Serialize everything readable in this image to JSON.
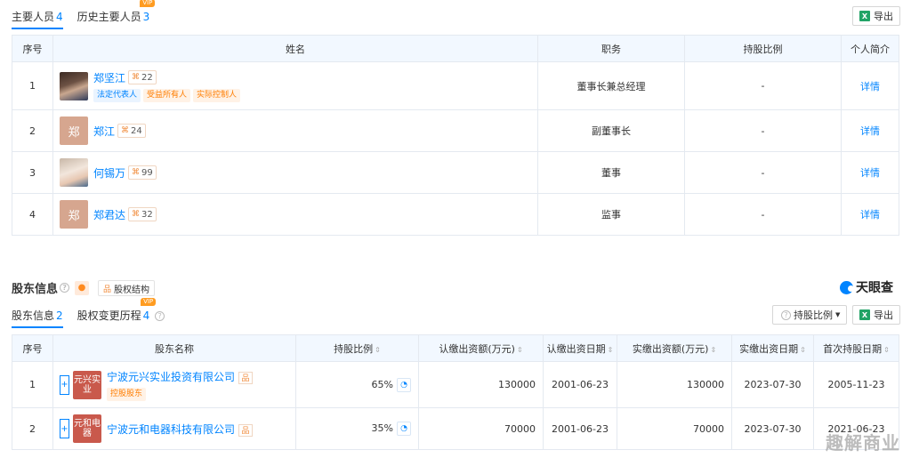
{
  "personnel": {
    "tabs": [
      {
        "label": "主要人员",
        "count": "4"
      },
      {
        "label": "历史主要人员",
        "count": "3",
        "badge": "VIP"
      }
    ],
    "export_label": "导出",
    "columns": [
      "序号",
      "姓名",
      "职务",
      "持股比例",
      "个人简介"
    ],
    "rows": [
      {
        "idx": "1",
        "name": "郑坚江",
        "relations": "22",
        "tags": [
          "法定代表人",
          "受益所有人",
          "实际控制人"
        ],
        "title": "董事长兼总经理",
        "ratio": "-",
        "detail": "详情"
      },
      {
        "idx": "2",
        "name": "郑江",
        "avatar_char": "郑",
        "relations": "24",
        "title": "副董事长",
        "ratio": "-",
        "detail": "详情"
      },
      {
        "idx": "3",
        "name": "何锡万",
        "relations": "99",
        "title": "董事",
        "ratio": "-",
        "detail": "详情"
      },
      {
        "idx": "4",
        "name": "郑君达",
        "avatar_char": "郑",
        "relations": "32",
        "title": "监事",
        "ratio": "-",
        "detail": "详情"
      }
    ]
  },
  "shareholders": {
    "title": "股东信息",
    "structure_label": "股权结构",
    "brand": "天眼查",
    "tabs": [
      {
        "label": "股东信息",
        "count": "2"
      },
      {
        "label": "股权变更历程",
        "count": "4",
        "badge": "VIP"
      }
    ],
    "filter_label": "持股比例",
    "export_label": "导出",
    "columns": [
      "序号",
      "股东名称",
      "持股比例",
      "认缴出资额(万元)",
      "认缴出资日期",
      "实缴出资额(万元)",
      "实缴出资日期",
      "首次持股日期"
    ],
    "rows": [
      {
        "idx": "1",
        "logo": "元兴实业",
        "name": "宁波元兴实业投资有限公司",
        "tag": "控股股东",
        "ratio": "65%",
        "subscribed": "130000",
        "subscribed_date": "2001-06-23",
        "paid": "130000",
        "paid_date": "2023-07-30",
        "first_date": "2005-11-23"
      },
      {
        "idx": "2",
        "logo": "元和电器",
        "name": "宁波元和电器科技有限公司",
        "ratio": "35%",
        "subscribed": "70000",
        "subscribed_date": "2001-06-23",
        "paid": "70000",
        "paid_date": "2023-07-30",
        "first_date": "2021-06-23"
      }
    ]
  },
  "watermark": "趣解商业"
}
